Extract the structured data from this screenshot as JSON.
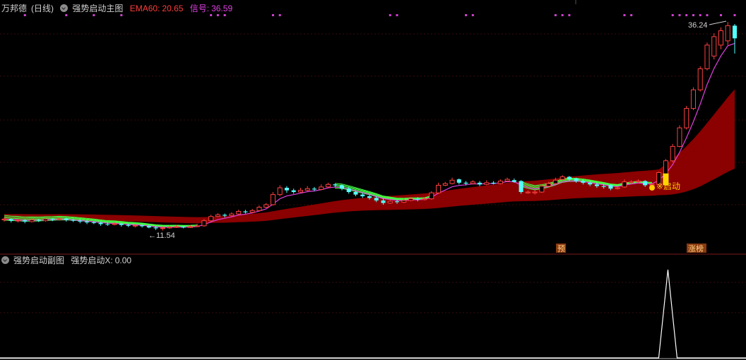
{
  "header": {
    "stock_name": "万邦德",
    "period": "(日线)",
    "main_indicator": "强势启动主图",
    "ema_label": "EMA60:",
    "ema_value": "20.65",
    "signal_label": "信号:",
    "signal_value": "36.59"
  },
  "sub_header": {
    "indicator": "强势启动副图",
    "x_label": "强势启动X:",
    "x_value": "0.00"
  },
  "annotations": {
    "low_label": "←11.54",
    "high_label": "36.24",
    "start_label": "※启动",
    "tag_yu": "预",
    "tag_zhangbang": "涨榜"
  },
  "colors": {
    "up": "#ff4040",
    "down": "#54ffff",
    "ema_band": "#8b0000",
    "ma_line": "#e040e0",
    "green_band": "#44ff44",
    "signal_dots": "#d040d0",
    "launch_bar": "#ffd700"
  },
  "chart_data": {
    "type": "candlestick",
    "price_range": [
      10,
      37
    ],
    "low_marker": 11.54,
    "high_marker": 36.24,
    "ema60": 20.65,
    "signal": 36.59,
    "candles": [
      [
        12.8,
        12.9,
        13.1,
        12.6
      ],
      [
        12.9,
        12.7,
        13.0,
        12.5
      ],
      [
        12.7,
        12.75,
        12.9,
        12.5
      ],
      [
        12.75,
        12.6,
        12.85,
        12.4
      ],
      [
        12.6,
        12.8,
        12.95,
        12.5
      ],
      [
        12.8,
        12.75,
        12.9,
        12.55
      ],
      [
        12.7,
        12.9,
        13.05,
        12.6
      ],
      [
        12.9,
        12.85,
        13.0,
        12.65
      ],
      [
        12.85,
        12.95,
        13.1,
        12.7
      ],
      [
        12.95,
        12.8,
        13.05,
        12.6
      ],
      [
        12.8,
        12.7,
        12.95,
        12.55
      ],
      [
        12.7,
        12.6,
        12.85,
        12.4
      ],
      [
        12.6,
        12.5,
        12.75,
        12.3
      ],
      [
        12.5,
        12.45,
        12.65,
        12.3
      ],
      [
        12.45,
        12.3,
        12.6,
        12.1
      ],
      [
        12.3,
        12.25,
        12.5,
        12.1
      ],
      [
        12.25,
        12.35,
        12.5,
        12.15
      ],
      [
        12.35,
        12.2,
        12.45,
        12.0
      ],
      [
        12.2,
        12.1,
        12.35,
        11.95
      ],
      [
        12.1,
        12.15,
        12.3,
        11.9
      ],
      [
        12.15,
        12.05,
        12.25,
        11.9
      ],
      [
        12.05,
        11.9,
        12.2,
        11.8
      ],
      [
        11.9,
        11.8,
        12.05,
        11.6
      ],
      [
        11.8,
        11.85,
        12.0,
        11.54
      ],
      [
        11.85,
        11.95,
        12.1,
        11.75
      ],
      [
        11.95,
        12.0,
        12.2,
        11.85
      ],
      [
        12.0,
        11.9,
        12.1,
        11.8
      ],
      [
        11.9,
        12.0,
        12.2,
        11.85
      ],
      [
        12.0,
        12.1,
        12.35,
        11.95
      ],
      [
        12.1,
        12.7,
        12.9,
        12.0
      ],
      [
        12.7,
        13.2,
        13.4,
        12.6
      ],
      [
        13.2,
        13.4,
        13.6,
        13.1
      ],
      [
        13.4,
        13.3,
        13.55,
        13.1
      ],
      [
        13.3,
        13.5,
        13.7,
        13.2
      ],
      [
        13.5,
        13.8,
        14.0,
        13.4
      ],
      [
        13.8,
        13.7,
        14.0,
        13.55
      ],
      [
        13.7,
        13.9,
        14.1,
        13.6
      ],
      [
        13.9,
        14.3,
        14.5,
        13.8
      ],
      [
        14.3,
        14.6,
        14.8,
        14.2
      ],
      [
        14.6,
        15.8,
        16.1,
        14.5
      ],
      [
        15.8,
        16.6,
        16.9,
        15.6
      ],
      [
        16.6,
        16.3,
        16.8,
        16.0
      ],
      [
        16.3,
        16.1,
        16.5,
        15.9
      ],
      [
        16.1,
        16.3,
        16.6,
        16.0
      ],
      [
        16.3,
        16.5,
        16.8,
        16.2
      ],
      [
        16.5,
        16.4,
        16.7,
        16.2
      ],
      [
        16.4,
        16.7,
        17.0,
        16.3
      ],
      [
        16.7,
        17.0,
        17.2,
        16.6
      ],
      [
        17.0,
        16.9,
        17.1,
        16.7
      ],
      [
        16.9,
        16.5,
        17.0,
        16.3
      ],
      [
        16.5,
        16.1,
        16.7,
        15.9
      ],
      [
        16.1,
        15.8,
        16.3,
        15.6
      ],
      [
        15.8,
        15.6,
        16.0,
        15.4
      ],
      [
        15.6,
        15.4,
        15.8,
        15.2
      ],
      [
        15.4,
        15.1,
        15.6,
        14.9
      ],
      [
        15.1,
        14.8,
        15.3,
        14.6
      ],
      [
        14.8,
        15.0,
        15.2,
        14.7
      ],
      [
        15.0,
        14.9,
        15.2,
        14.7
      ],
      [
        14.9,
        15.1,
        15.3,
        14.8
      ],
      [
        15.1,
        15.3,
        15.5,
        15.0
      ],
      [
        15.3,
        15.2,
        15.5,
        15.0
      ],
      [
        15.2,
        15.3,
        15.5,
        15.1
      ],
      [
        15.3,
        16.0,
        16.2,
        15.2
      ],
      [
        16.0,
        16.9,
        17.2,
        15.9
      ],
      [
        16.9,
        17.1,
        17.3,
        16.8
      ],
      [
        17.1,
        17.5,
        17.8,
        17.0
      ],
      [
        17.6,
        17.2,
        17.7,
        17.0
      ],
      [
        17.2,
        17.1,
        17.4,
        16.9
      ],
      [
        17.1,
        17.3,
        17.5,
        17.0
      ],
      [
        17.2,
        17.0,
        17.4,
        16.8
      ],
      [
        17.0,
        17.2,
        17.5,
        16.9
      ],
      [
        17.2,
        17.1,
        17.4,
        17.0
      ],
      [
        17.1,
        17.4,
        17.6,
        17.0
      ],
      [
        17.4,
        17.6,
        17.8,
        17.3
      ],
      [
        17.5,
        17.3,
        17.7,
        17.2
      ],
      [
        17.4,
        16.1,
        17.5,
        15.9
      ],
      [
        16.0,
        16.1,
        16.3,
        15.9
      ],
      [
        16.0,
        16.1,
        16.3,
        15.8
      ],
      [
        16.1,
        16.8,
        17.0,
        16.0
      ],
      [
        16.8,
        17.1,
        17.3,
        16.7
      ],
      [
        17.1,
        17.5,
        17.8,
        17.0
      ],
      [
        17.6,
        17.9,
        18.1,
        17.5
      ],
      [
        17.9,
        17.6,
        18.0,
        17.4
      ],
      [
        17.7,
        17.4,
        17.8,
        17.2
      ],
      [
        17.4,
        17.2,
        17.6,
        17.0
      ],
      [
        17.2,
        17.0,
        17.4,
        16.8
      ],
      [
        17.0,
        16.8,
        17.2,
        16.6
      ],
      [
        16.8,
        16.7,
        17.0,
        16.5
      ],
      [
        16.9,
        16.5,
        17.0,
        16.3
      ],
      [
        16.5,
        16.6,
        16.8,
        16.4
      ],
      [
        16.7,
        17.3,
        17.6,
        16.6
      ],
      [
        17.2,
        17.3,
        17.5,
        17.1
      ],
      [
        17.3,
        17.4,
        17.6,
        17.2
      ],
      [
        17.4,
        16.9,
        17.5,
        16.7
      ],
      [
        16.9,
        17.0,
        17.2,
        16.8
      ],
      [
        17.0,
        18.4,
        18.5,
        16.9
      ],
      [
        18.2,
        19.8,
        20.0,
        18.1
      ],
      [
        19.8,
        21.5,
        21.8,
        19.6
      ],
      [
        21.5,
        23.7,
        24.0,
        21.4
      ],
      [
        23.7,
        26.0,
        26.3,
        23.5
      ],
      [
        26.0,
        28.2,
        28.5,
        25.8
      ],
      [
        28.2,
        30.7,
        31.0,
        28.0
      ],
      [
        30.7,
        33.5,
        33.8,
        30.5
      ],
      [
        32.2,
        34.5,
        34.9,
        31.8
      ],
      [
        33.5,
        35.2,
        35.6,
        33.0
      ],
      [
        34.0,
        35.8,
        36.24,
        33.5
      ],
      [
        35.8,
        34.3,
        36.0,
        32.5
      ]
    ]
  }
}
